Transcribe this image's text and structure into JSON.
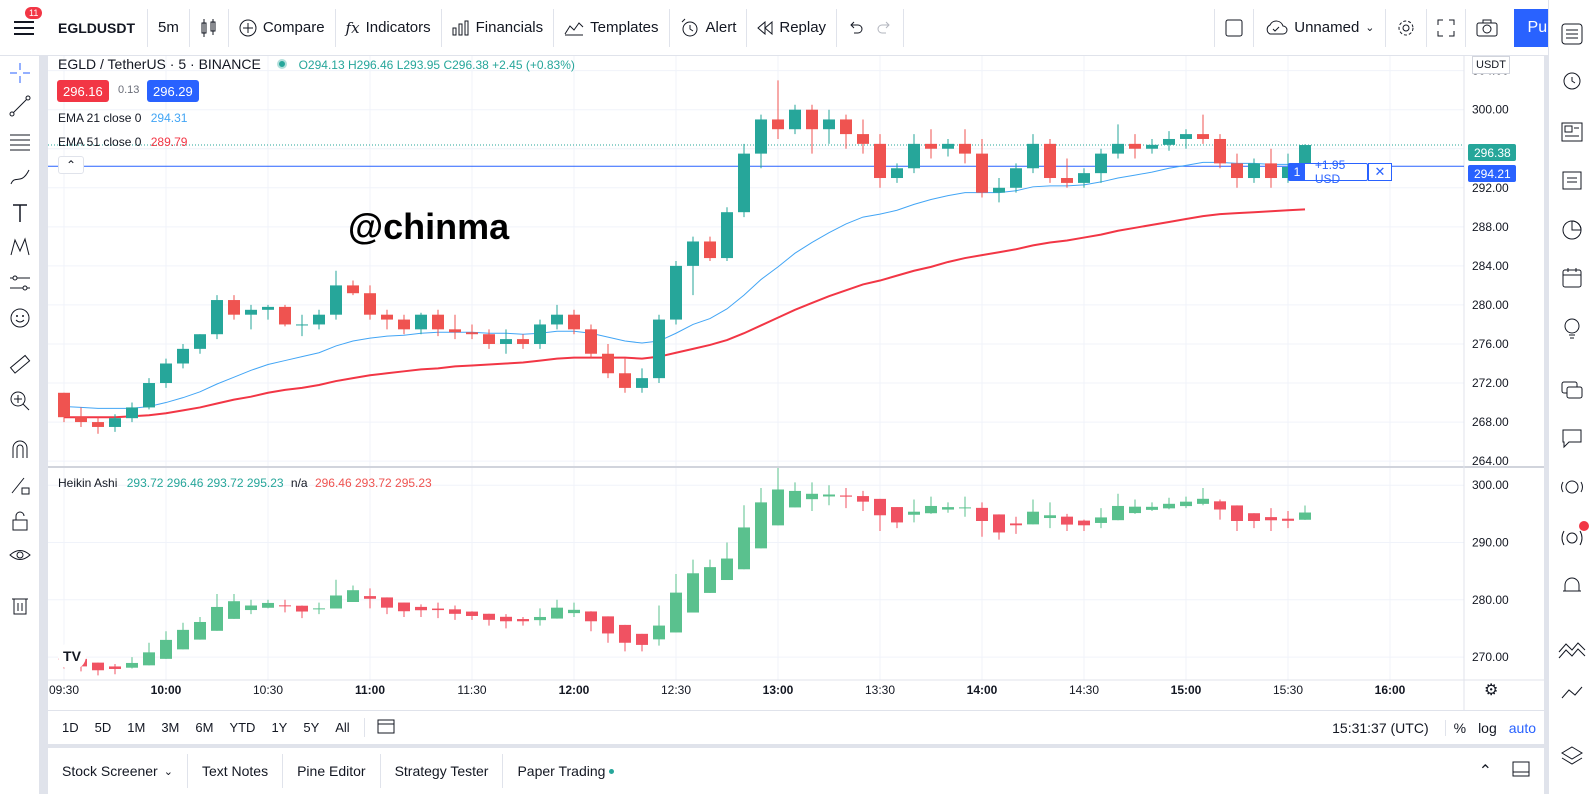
{
  "toolbar": {
    "notifications": "11",
    "symbol": "EGLDUSDT",
    "interval": "5m",
    "compare": "Compare",
    "indicators": "Indicators",
    "financials": "Financials",
    "templates": "Templates",
    "alert": "Alert",
    "replay": "Replay",
    "layout_name": "Unnamed",
    "publish": "Publish"
  },
  "legend": {
    "pair": "EGLD / TetherUS · 5 · BINANCE",
    "open": "O294.13",
    "high": "H296.46",
    "low": "L293.95",
    "close": "C296.38",
    "change": "+2.45 (+0.83%)",
    "bid": "296.16",
    "spread": "0.13",
    "ask": "296.29",
    "ema21_label": "EMA 21 close 0",
    "ema21_value": "294.31",
    "ema51_label": "EMA 51 close 0",
    "ema51_value": "289.79",
    "heikin_label": "Heikin Ashi",
    "heikin_o": "293.72",
    "heikin_h": "296.46",
    "heikin_l": "293.72",
    "heikin_c": "295.23",
    "heikin_na": "n/a",
    "heikin_o2": "296.46",
    "heikin_h2": "293.72",
    "heikin_c2": "295.23"
  },
  "watermark": "@chinma",
  "currency": "USDT",
  "price_tag": "296.38",
  "alert_line": {
    "level": "1",
    "text": "+1.95 USD",
    "price": "294.21"
  },
  "price_axis": [
    "304.00",
    "300.00",
    "296.00",
    "292.00",
    "288.00",
    "284.00",
    "280.00",
    "276.00",
    "272.00",
    "268.00",
    "264.00"
  ],
  "price_axis2": [
    "300.00",
    "290.00",
    "280.00",
    "270.00"
  ],
  "time_axis": [
    "09:30",
    "10:00",
    "10:30",
    "11:00",
    "11:30",
    "12:00",
    "12:30",
    "13:00",
    "13:30",
    "14:00",
    "14:30",
    "15:00",
    "15:30",
    "16:00"
  ],
  "ranges": [
    "1D",
    "5D",
    "1M",
    "3M",
    "6M",
    "YTD",
    "1Y",
    "5Y",
    "All"
  ],
  "clock": "15:31:37 (UTC)",
  "scale": {
    "percent": "%",
    "log": "log",
    "auto": "auto"
  },
  "bottom_tabs": [
    "Stock Screener",
    "Text Notes",
    "Pine Editor",
    "Strategy Tester",
    "Paper Trading"
  ],
  "colors": {
    "up": "#26a69a",
    "down": "#ef5350",
    "ema21": "#42a5f5",
    "ema51": "#f23645",
    "accent": "#2962ff"
  },
  "chart_data": {
    "type": "candlestick",
    "interval": "5m",
    "candles": [
      [
        271.0,
        271.0,
        268.0,
        268.5
      ],
      [
        268.5,
        269.5,
        267.5,
        268.0
      ],
      [
        268.0,
        268.5,
        266.8,
        267.5
      ],
      [
        267.5,
        268.8,
        267.0,
        268.4
      ],
      [
        268.4,
        270.0,
        268.0,
        269.5
      ],
      [
        269.5,
        272.5,
        269.3,
        272.0
      ],
      [
        272.0,
        274.5,
        271.5,
        274.0
      ],
      [
        274.0,
        276.0,
        273.5,
        275.5
      ],
      [
        275.5,
        277.0,
        275.0,
        277.0
      ],
      [
        277.0,
        281.0,
        276.5,
        280.5
      ],
      [
        280.5,
        281.0,
        278.5,
        279.0
      ],
      [
        279.0,
        280.0,
        277.5,
        279.5
      ],
      [
        279.5,
        280.0,
        278.5,
        279.8
      ],
      [
        279.8,
        280.0,
        277.8,
        278.0
      ],
      [
        278.0,
        279.0,
        276.8,
        278.0
      ],
      [
        278.0,
        279.5,
        277.5,
        279.0
      ],
      [
        279.0,
        283.5,
        278.5,
        282.0
      ],
      [
        282.0,
        282.5,
        281.0,
        281.2
      ],
      [
        281.2,
        282.0,
        278.5,
        279.0
      ],
      [
        279.0,
        279.5,
        277.5,
        278.5
      ],
      [
        278.5,
        279.0,
        277.0,
        277.5
      ],
      [
        277.5,
        279.2,
        277.0,
        279.0
      ],
      [
        279.0,
        279.5,
        276.8,
        277.5
      ],
      [
        277.5,
        279.0,
        276.5,
        277.2
      ],
      [
        277.2,
        278.0,
        276.5,
        277.0
      ],
      [
        277.0,
        277.5,
        275.5,
        276.0
      ],
      [
        276.0,
        277.5,
        275.0,
        276.5
      ],
      [
        276.5,
        277.0,
        275.5,
        276.0
      ],
      [
        276.0,
        278.5,
        275.5,
        278.0
      ],
      [
        278.0,
        280.0,
        277.5,
        279.0
      ],
      [
        279.0,
        279.5,
        277.0,
        277.5
      ],
      [
        277.5,
        278.0,
        274.5,
        275.0
      ],
      [
        275.0,
        276.0,
        272.5,
        273.0
      ],
      [
        273.0,
        274.5,
        271.0,
        271.5
      ],
      [
        271.5,
        273.5,
        271.0,
        272.5
      ],
      [
        272.5,
        279.0,
        272.0,
        278.5
      ],
      [
        278.5,
        284.5,
        278.0,
        284.0
      ],
      [
        284.0,
        287.0,
        281.0,
        286.5
      ],
      [
        286.5,
        287.0,
        284.5,
        284.8
      ],
      [
        284.8,
        290.0,
        284.5,
        289.5
      ],
      [
        289.5,
        296.5,
        289.0,
        295.5
      ],
      [
        295.5,
        299.5,
        294.0,
        299.0
      ],
      [
        299.0,
        303.0,
        297.0,
        298.0
      ],
      [
        298.0,
        300.5,
        297.5,
        300.0
      ],
      [
        300.0,
        300.5,
        295.5,
        298.0
      ],
      [
        298.0,
        300.0,
        296.5,
        299.0
      ],
      [
        299.0,
        299.5,
        296.0,
        297.5
      ],
      [
        297.5,
        299.0,
        295.5,
        296.5
      ],
      [
        296.5,
        297.5,
        292.0,
        293.0
      ],
      [
        293.0,
        294.5,
        292.5,
        294.0
      ],
      [
        294.0,
        297.5,
        293.5,
        296.5
      ],
      [
        296.5,
        298.0,
        295.0,
        296.0
      ],
      [
        296.0,
        297.0,
        295.2,
        296.5
      ],
      [
        296.5,
        298.0,
        294.5,
        295.5
      ],
      [
        295.5,
        297.0,
        291.0,
        291.5
      ],
      [
        291.5,
        293.0,
        290.5,
        292.0
      ],
      [
        292.0,
        294.5,
        291.5,
        294.0
      ],
      [
        294.0,
        297.5,
        293.5,
        296.5
      ],
      [
        296.5,
        297.0,
        292.5,
        293.0
      ],
      [
        293.0,
        295.0,
        292.0,
        292.5
      ],
      [
        292.5,
        294.0,
        292.0,
        293.5
      ],
      [
        293.5,
        296.0,
        292.5,
        295.5
      ],
      [
        295.5,
        298.5,
        295.0,
        296.5
      ],
      [
        296.5,
        297.5,
        295.0,
        296.0
      ],
      [
        296.0,
        297.0,
        295.5,
        296.4
      ],
      [
        296.4,
        297.8,
        295.8,
        297.0
      ],
      [
        297.0,
        298.0,
        296.0,
        297.5
      ],
      [
        297.5,
        299.5,
        296.5,
        297.0
      ],
      [
        297.0,
        297.5,
        294.0,
        294.5
      ],
      [
        294.5,
        295.5,
        292.0,
        293.0
      ],
      [
        293.0,
        295.0,
        292.5,
        294.5
      ],
      [
        294.5,
        296.0,
        292.0,
        293.0
      ],
      [
        293.0,
        295.5,
        292.5,
        294.13
      ],
      [
        294.13,
        296.46,
        293.95,
        296.38
      ]
    ],
    "ema21": [
      269.6,
      269.5,
      269.4,
      269.4,
      269.4,
      269.6,
      270.0,
      270.5,
      271.1,
      271.9,
      272.6,
      273.3,
      273.9,
      274.3,
      274.7,
      275.1,
      275.8,
      276.3,
      276.6,
      276.8,
      276.9,
      277.1,
      277.2,
      277.2,
      277.2,
      277.1,
      277.1,
      277.0,
      277.1,
      277.3,
      277.3,
      277.1,
      276.7,
      276.3,
      276.1,
      276.3,
      277.1,
      278.0,
      278.6,
      279.6,
      281.0,
      282.6,
      283.9,
      285.3,
      286.4,
      287.4,
      288.3,
      289.0,
      289.3,
      289.7,
      290.3,
      290.8,
      291.2,
      291.5,
      291.5,
      291.5,
      291.7,
      292.1,
      292.2,
      292.2,
      292.3,
      292.6,
      293.0,
      293.3,
      293.6,
      294.0,
      294.3,
      294.6,
      294.6,
      294.5,
      294.5,
      294.4,
      294.4,
      294.31
    ],
    "ema51": [
      268.5,
      268.5,
      268.5,
      268.5,
      268.6,
      268.7,
      268.9,
      269.2,
      269.5,
      269.9,
      270.3,
      270.6,
      271.0,
      271.3,
      271.5,
      271.8,
      272.2,
      272.5,
      272.8,
      273.0,
      273.2,
      273.4,
      273.5,
      273.7,
      273.8,
      273.9,
      274.0,
      274.1,
      274.3,
      274.5,
      274.6,
      274.6,
      274.6,
      274.6,
      274.5,
      274.7,
      275.1,
      275.5,
      275.9,
      276.4,
      277.1,
      277.9,
      278.7,
      279.5,
      280.2,
      280.9,
      281.5,
      282.1,
      282.5,
      283.0,
      283.5,
      283.9,
      284.4,
      284.8,
      285.1,
      285.4,
      285.7,
      286.1,
      286.4,
      286.6,
      286.9,
      287.2,
      287.6,
      287.9,
      288.2,
      288.5,
      288.8,
      289.1,
      289.3,
      289.4,
      289.5,
      289.6,
      289.7,
      289.79
    ],
    "price_range": [
      263.5,
      305.5
    ],
    "heikin_range": [
      266,
      303
    ]
  }
}
